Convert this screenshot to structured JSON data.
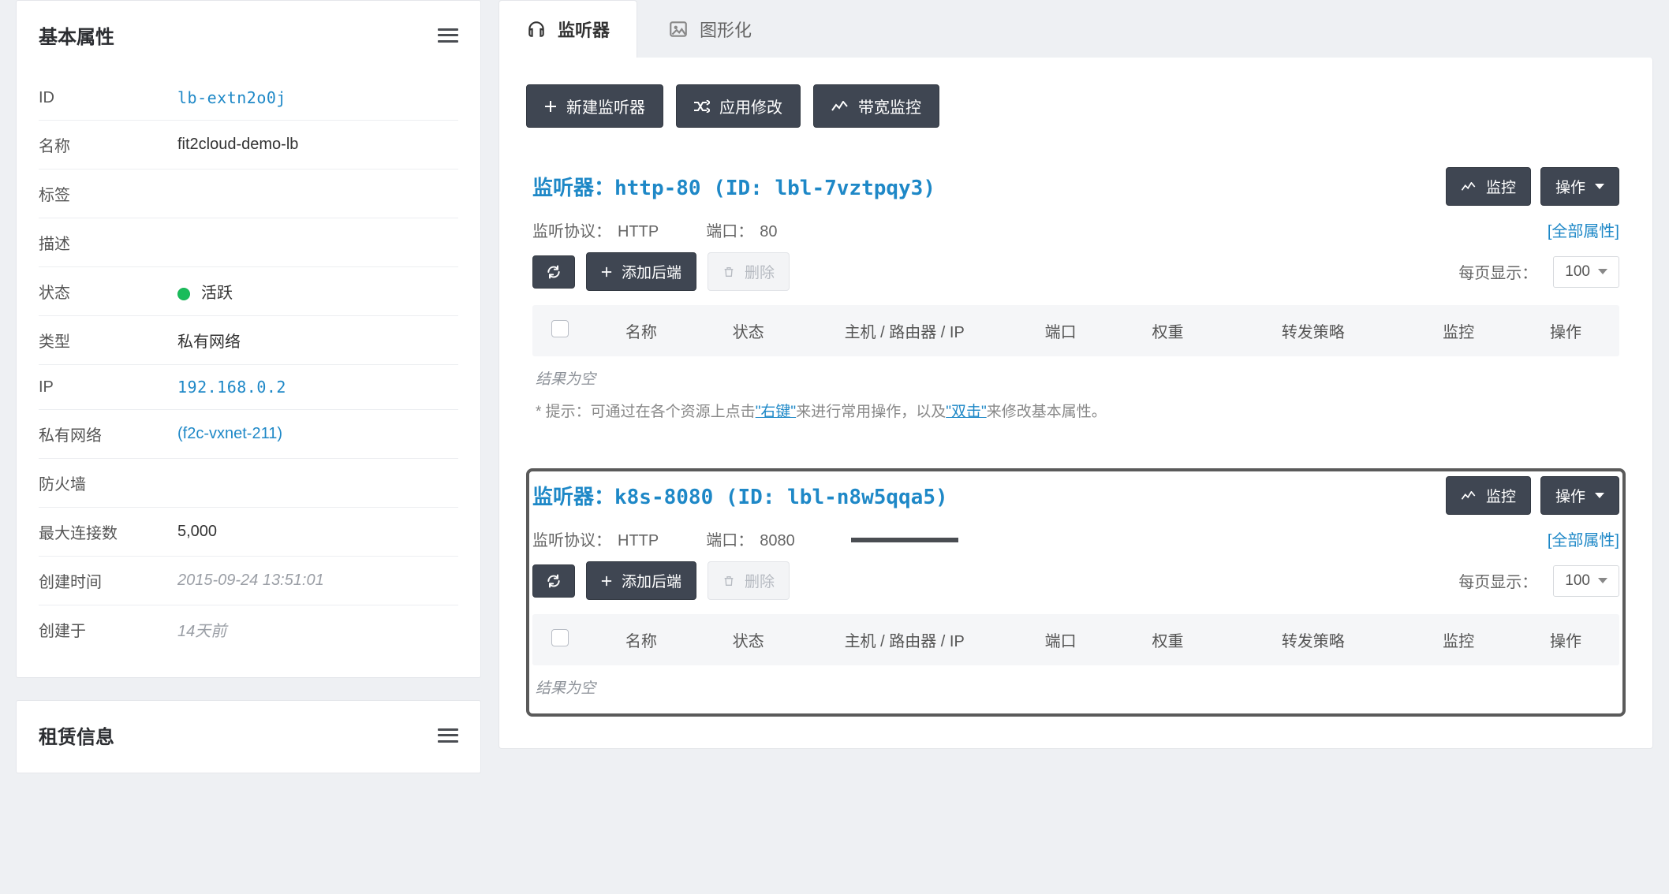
{
  "sidebar": {
    "panel1_title": "基本属性",
    "panel2_title": "租赁信息",
    "attrs": {
      "id": {
        "label": "ID",
        "value": "lb-extn2o0j",
        "link": true,
        "mono": true
      },
      "name": {
        "label": "名称",
        "value": "fit2cloud-demo-lb"
      },
      "tags": {
        "label": "标签",
        "value": ""
      },
      "desc": {
        "label": "描述",
        "value": ""
      },
      "status": {
        "label": "状态",
        "value": "活跃",
        "state": "active"
      },
      "type": {
        "label": "类型",
        "value": "私有网络"
      },
      "ip": {
        "label": "IP",
        "value": "192.168.0.2",
        "link": true,
        "mono": true
      },
      "vxnet": {
        "label": "私有网络",
        "value": "(f2c-vxnet-211)",
        "link": true
      },
      "firewall": {
        "label": "防火墙",
        "value": ""
      },
      "maxconn": {
        "label": "最大连接数",
        "value": "5,000"
      },
      "created": {
        "label": "创建时间",
        "value": "2015-09-24 13:51:01",
        "muted": true
      },
      "createdby": {
        "label": "创建于",
        "value": "14天前",
        "muted": true
      }
    }
  },
  "tabs": {
    "listeners": "监听器",
    "graph": "图形化"
  },
  "actions": {
    "new_listener": "新建监听器",
    "apply_changes": "应用修改",
    "bandwidth_monitor": "带宽监控",
    "monitor": "监控",
    "operate": "操作",
    "add_backend": "添加后端",
    "delete": "删除"
  },
  "labels": {
    "listener_prefix": "监听器：",
    "id_prefix": "ID: ",
    "protocol": "监听协议：",
    "port": "端口：",
    "all_attrs": "[全部属性]",
    "per_page": "每页显示：",
    "per_page_value": "100",
    "empty": "结果为空",
    "hint_pre": "* 提示：可通过在各个资源上点击",
    "hint_q1": "\"右键\"",
    "hint_mid": "来进行常用操作，以及",
    "hint_q2": "\"双击\"",
    "hint_post": "来修改基本属性。"
  },
  "columns": {
    "name": "名称",
    "status": "状态",
    "host": "主机 / 路由器 / IP",
    "port": "端口",
    "weight": "权重",
    "policy": "转发策略",
    "monitor": "监控",
    "operate": "操作"
  },
  "listeners": [
    {
      "name": "http-80",
      "id": "lbl-7vztpqy3",
      "protocol": "HTTP",
      "port": "80",
      "highlight": false
    },
    {
      "name": "k8s-8080",
      "id": "lbl-n8w5qqa5",
      "protocol": "HTTP",
      "port": "8080",
      "highlight": true
    }
  ]
}
